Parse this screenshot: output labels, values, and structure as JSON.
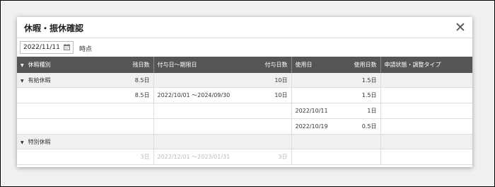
{
  "dialog": {
    "title": "休暇・振休確認"
  },
  "filter": {
    "date_value": "2022/11/11",
    "suffix": "時点"
  },
  "table": {
    "headers": {
      "type": "休暇種別",
      "remaining": "残日数",
      "period": "付与日～期限日",
      "granted": "付与日数",
      "used_date": "使用日",
      "used_days": "使用日数",
      "status": "申請状態・調整タイプ"
    },
    "rows": [
      {
        "kind": "category",
        "type": "有給休暇",
        "remaining": "8.5日",
        "period": "",
        "granted": "10日",
        "used_date": "",
        "used_days": "1.5日",
        "status": ""
      },
      {
        "kind": "detail",
        "type": "",
        "remaining": "8.5日",
        "period": "2022/10/01 ～2024/09/30",
        "granted": "10日",
        "used_date": "",
        "used_days": "1.5日",
        "status": ""
      },
      {
        "kind": "detail",
        "type": "",
        "remaining": "",
        "period": "",
        "granted": "",
        "used_date": "2022/10/11",
        "used_days": "1日",
        "status": ""
      },
      {
        "kind": "detail",
        "type": "",
        "remaining": "",
        "period": "",
        "granted": "",
        "used_date": "2022/10/19",
        "used_days": "0.5日",
        "status": ""
      },
      {
        "kind": "category",
        "type": "特別休暇",
        "remaining": "",
        "period": "",
        "granted": "",
        "used_date": "",
        "used_days": "",
        "status": ""
      },
      {
        "kind": "dim",
        "type": "",
        "remaining": "3日",
        "period": "2022/12/01 ～2023/01/31",
        "granted": "3日",
        "used_date": "",
        "used_days": "",
        "status": ""
      }
    ]
  }
}
